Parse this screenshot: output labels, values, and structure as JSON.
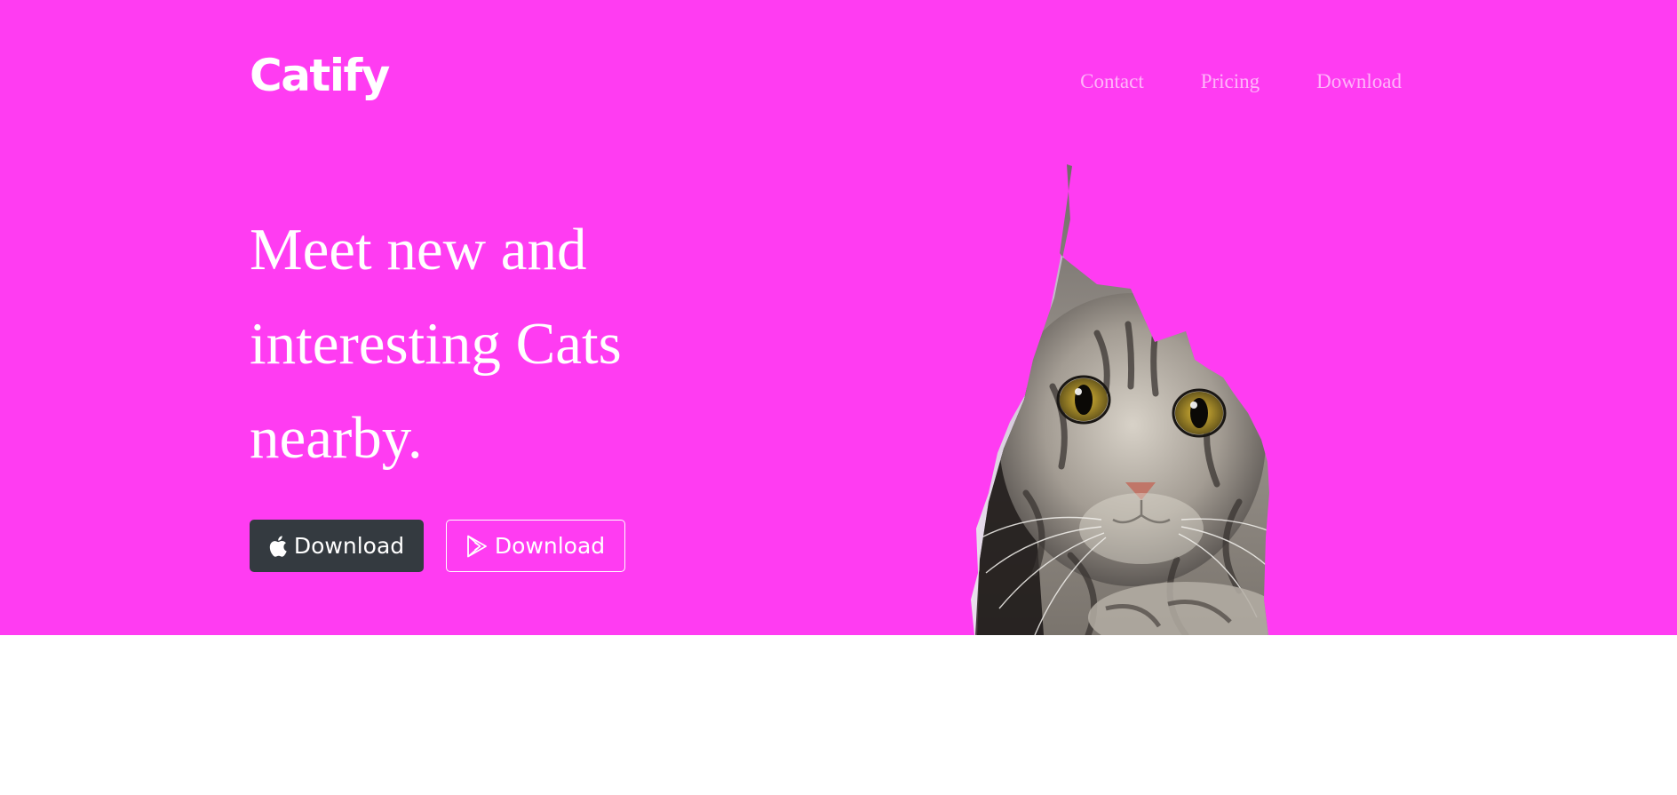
{
  "brand": {
    "name": "Catify"
  },
  "nav": {
    "items": [
      "Contact",
      "Pricing",
      "Download"
    ]
  },
  "hero": {
    "headline": "Meet new and interesting Cats nearby.",
    "buttons": {
      "ios_label": "Download",
      "android_label": "Download"
    },
    "image": {
      "subject": "tabby cat peeking through torn paper"
    }
  },
  "icons": {
    "ios": "apple-icon",
    "android": "google-play-icon"
  },
  "colors": {
    "hero_background": "#ff3cf2",
    "dark_button": "#343a40",
    "text": "#ffffff",
    "page_background": "#ffffff"
  }
}
